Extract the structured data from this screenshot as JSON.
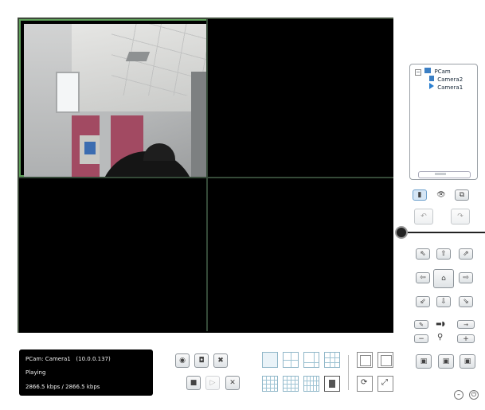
{
  "tree": {
    "root_label": "PCam",
    "cameras": [
      "Camera2",
      "Camera1"
    ]
  },
  "status": {
    "camera_line": "PCam: Camera1",
    "camera_ip": "(10.0.0.137)",
    "state": "Playing",
    "bitrate": "2866.5 kbps / 2866.5 kbps"
  },
  "icons": {
    "ptz_up": "arrow-up-icon",
    "ptz_down": "arrow-down-icon",
    "ptz_left": "arrow-left-icon",
    "ptz_right": "arrow-right-icon",
    "ptz_home": "home-icon",
    "zoom": "magnifier-icon"
  },
  "colors": {
    "selected_border": "#5fa05a",
    "grid_border": "#354a38",
    "accent": "#8fb6c8"
  }
}
